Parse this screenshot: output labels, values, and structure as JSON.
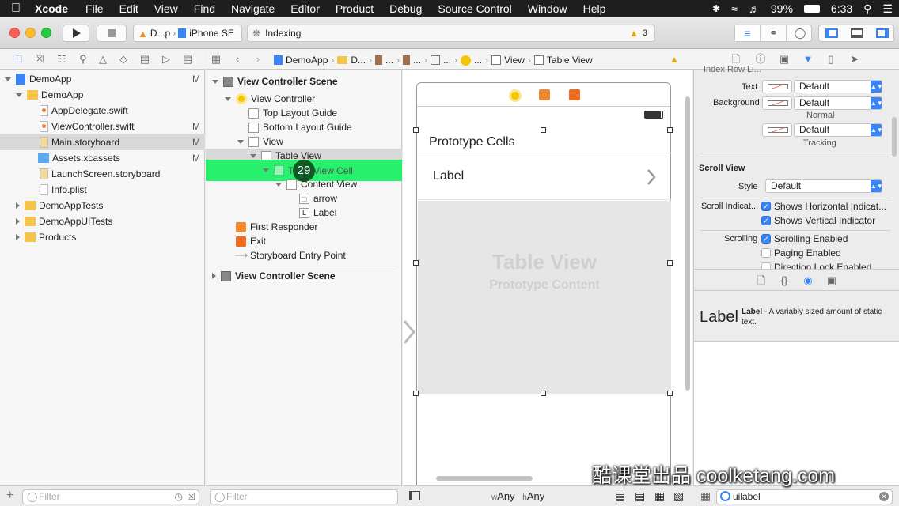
{
  "menubar": {
    "app": "Xcode",
    "items": [
      "File",
      "Edit",
      "View",
      "Find",
      "Navigate",
      "Editor",
      "Product",
      "Debug",
      "Source Control",
      "Window",
      "Help"
    ],
    "battery": "99%",
    "time": "6:33"
  },
  "toolbar": {
    "scheme_app": "D...p",
    "scheme_device": "iPhone SE",
    "activity": "Indexing",
    "warning_count": "3"
  },
  "jumpbar": {
    "items": [
      "DemoApp",
      "D...",
      "...",
      "...",
      "...",
      "...",
      "View",
      "Table View"
    ]
  },
  "navigator": {
    "rows": [
      {
        "label": "DemoApp",
        "badge": "M"
      },
      {
        "label": "DemoApp",
        "badge": ""
      },
      {
        "label": "AppDelegate.swift",
        "badge": ""
      },
      {
        "label": "ViewController.swift",
        "badge": "M"
      },
      {
        "label": "Main.storyboard",
        "badge": "M"
      },
      {
        "label": "Assets.xcassets",
        "badge": "M"
      },
      {
        "label": "LaunchScreen.storyboard",
        "badge": ""
      },
      {
        "label": "Info.plist",
        "badge": ""
      },
      {
        "label": "DemoAppTests",
        "badge": ""
      },
      {
        "label": "DemoAppUITests",
        "badge": ""
      },
      {
        "label": "Products",
        "badge": ""
      }
    ],
    "filter_placeholder": "Filter"
  },
  "outline": {
    "rows": [
      "View Controller Scene",
      "View Controller",
      "Top Layout Guide",
      "Bottom Layout Guide",
      "View",
      "Table View",
      "Table View Cell",
      "Content View",
      "arrow",
      "Label",
      "First Responder",
      "Exit",
      "Storyboard Entry Point",
      "View Controller Scene"
    ],
    "step_badge": "29",
    "filter_placeholder": "Filter"
  },
  "canvas": {
    "section_header": "Prototype Cells",
    "cell_label": "Label",
    "placeholder_title": "Table View",
    "placeholder_subtitle": "Prototype Content",
    "size_w": "Any",
    "size_h": "Any"
  },
  "inspector": {
    "cutoff_label": "Index Row Li...",
    "text_label": "Text",
    "text_value": "Default",
    "background_label": "Background",
    "background_value": "Default",
    "normal_label": "Normal",
    "tracking_value": "Default",
    "tracking_label": "Tracking",
    "scroll_view_header": "Scroll View",
    "style_label": "Style",
    "style_value": "Default",
    "scroll_indicators_label": "Scroll Indicat...",
    "shows_horizontal": "Shows Horizontal Indicat...",
    "shows_vertical": "Shows Vertical Indicator",
    "scrolling_label": "Scrolling",
    "scrolling_enabled": "Scrolling Enabled",
    "paging_enabled": "Paging Enabled",
    "direction_lock": "Direction Lock Enabled",
    "library_item_icon_text": "Label",
    "library_item_title": "Label",
    "library_item_desc": "- A variably sized amount of static text.",
    "library_search": "uilabel"
  },
  "watermark": "酷课堂出品 coolketang.com",
  "colors": {
    "accent": "#3b84f6",
    "highlight": "#26f06c",
    "selection": "#d9d9d9"
  }
}
